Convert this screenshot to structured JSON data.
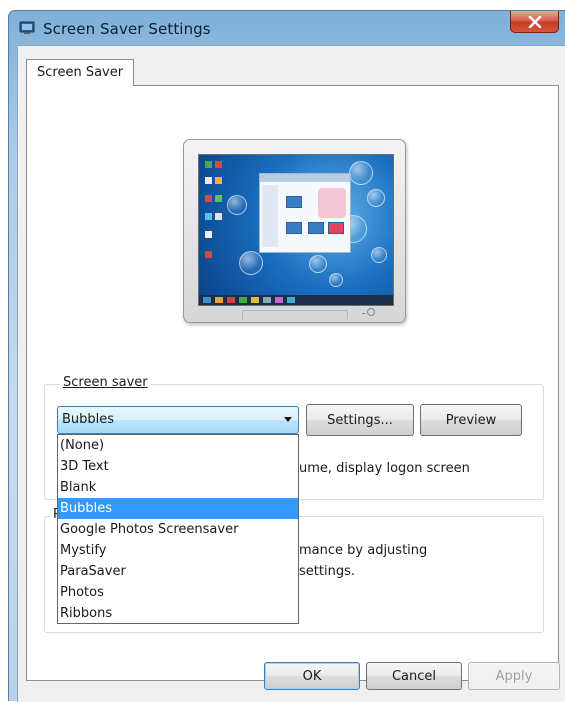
{
  "window": {
    "title": "Screen Saver Settings"
  },
  "tabs": [
    {
      "label": "Screen Saver"
    }
  ],
  "screen_saver": {
    "group_label": "Screen saver",
    "selected": "Bubbles",
    "settings_label": "Settings...",
    "preview_label": "Preview",
    "options": [
      "(None)",
      "3D Text",
      "Blank",
      "Bubbles",
      "Google Photos Screensaver",
      "Mystify",
      "ParaSaver",
      "Photos",
      "Ribbons"
    ],
    "resume_text": "ume, display logon screen"
  },
  "power": {
    "group_label": "P",
    "text_line1": "mance by adjusting",
    "text_line2": "settings."
  },
  "footer": {
    "ok_label": "OK",
    "cancel_label": "Cancel",
    "apply_label": "Apply"
  },
  "colors": {
    "selection": "#3399ff",
    "close_button": "#c23b22",
    "title_bar": "#a9cbe7"
  },
  "icons": [
    "screen-saver-app-icon",
    "close-icon",
    "dropdown-arrow-icon",
    "monitor-preview-icon"
  ]
}
